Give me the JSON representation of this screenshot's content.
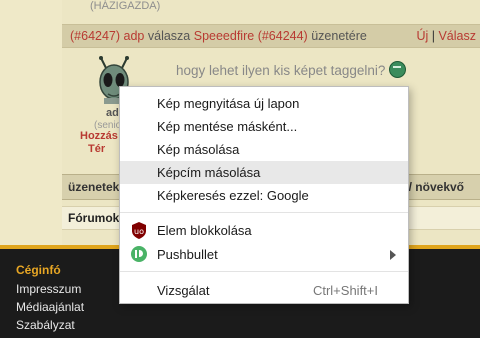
{
  "post": {
    "role_top": "(HÁZIGAZDA)",
    "header_ref": "(#64247)",
    "header_author": "adp",
    "header_middle": " válasza ",
    "header_reply_to": "Speeedfire",
    "header_ref2": "(#64244)",
    "header_end": " üzenetére",
    "action_new": "Új",
    "action_separator": "|",
    "action_reply": "Válasz",
    "text": "hogy lehet ilyen kis képet taggelni?",
    "smiley_icon": "smiley-icon",
    "user_name": "ad",
    "user_role": "(senio",
    "user_link1": "Hozzás",
    "user_link2": "Tér"
  },
  "bars": {
    "topics_label": "üzenetek",
    "sort_label": "/ növekvő",
    "forums_label": "Fórumok"
  },
  "footer": {
    "title": "Céginfó",
    "links": [
      "Impresszum",
      "Médiaajánlat",
      "Szabályzat"
    ]
  },
  "context_menu": {
    "items": [
      {
        "label": "Kép megnyitása új lapon"
      },
      {
        "label": "Kép mentése másként..."
      },
      {
        "label": "Kép másolása"
      },
      {
        "label": "Képcím másolása",
        "highlighted": true
      },
      {
        "label": "Képkeresés ezzel: Google"
      },
      {
        "label": "Elem blokkolása",
        "icon": "ublock-icon"
      },
      {
        "label": "Pushbullet",
        "icon": "pushbullet-icon",
        "submenu": true
      },
      {
        "label": "Vizsgálat",
        "shortcut": "Ctrl+Shift+I"
      }
    ]
  },
  "colors": {
    "link": "#b83a32",
    "footer_bg": "#1b1b1b",
    "footer_accent": "#e0a51c",
    "page_bg": "#efe9c8"
  }
}
